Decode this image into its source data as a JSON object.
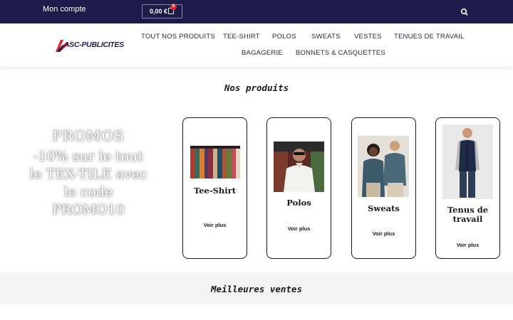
{
  "topbar": {
    "account_label": "Mon compte",
    "cart_total": "0,00 €",
    "cart_count": "0"
  },
  "brand": {
    "logo_text": "ASC-PUBLICITES"
  },
  "nav": {
    "items": [
      {
        "label": "TOUT NOS PRODUITS"
      },
      {
        "label": "TEE-SHIRT"
      },
      {
        "label": "POLOS"
      },
      {
        "label": "SWEATS"
      },
      {
        "label": "VESTES"
      },
      {
        "label": "TENUES DE TRAVAIL"
      },
      {
        "label": "BAGAGERIE"
      },
      {
        "label": "BONNETS & CASQUETTES"
      }
    ]
  },
  "products_section": {
    "title": "Nos produits"
  },
  "promo": {
    "heading": "PROMOS",
    "body": "-10% sur le tout le TEX-TILE avec le code PROMO10"
  },
  "categories": [
    {
      "name": "Tee-Shirt",
      "cta": "Voir plus"
    },
    {
      "name": "Polos",
      "cta": "Voir plus"
    },
    {
      "name": "Sweats",
      "cta": "Voir plus"
    },
    {
      "name": "Tenus de travail",
      "cta": "Voir plus"
    }
  ],
  "bestsellers": {
    "title": "Meilleures ventes"
  },
  "colors": {
    "topbar_bg": "#1c1b4a",
    "badge": "#e0222d",
    "logo_red": "#d6262b"
  }
}
